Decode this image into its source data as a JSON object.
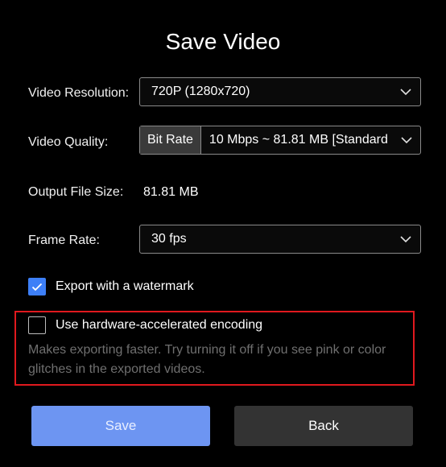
{
  "dialog": {
    "title": "Save Video"
  },
  "resolution": {
    "label": "Video Resolution:",
    "value": "720P (1280x720)"
  },
  "quality": {
    "label": "Video Quality:",
    "mode": "Bit Rate",
    "value": "10 Mbps ~ 81.81 MB [Standard"
  },
  "output_size": {
    "label": "Output File Size:",
    "value": "81.81 MB"
  },
  "frame_rate": {
    "label": "Frame Rate:",
    "value": "30 fps"
  },
  "watermark": {
    "label": "Export with a watermark",
    "checked": true
  },
  "hardware": {
    "label": "Use hardware-accelerated encoding",
    "checked": false,
    "hint": "Makes exporting faster. Try turning it off if you see pink or color glitches in the exported videos."
  },
  "buttons": {
    "save": "Save",
    "back": "Back"
  },
  "colors": {
    "accent": "#3d7ff7",
    "save_button": "#6d95f2",
    "back_button": "#333333",
    "highlight": "#e0191e",
    "hint_text": "#6f6f6f"
  },
  "icons": {
    "dropdown": "chevron-down-icon",
    "checkmark": "checkmark-icon"
  }
}
